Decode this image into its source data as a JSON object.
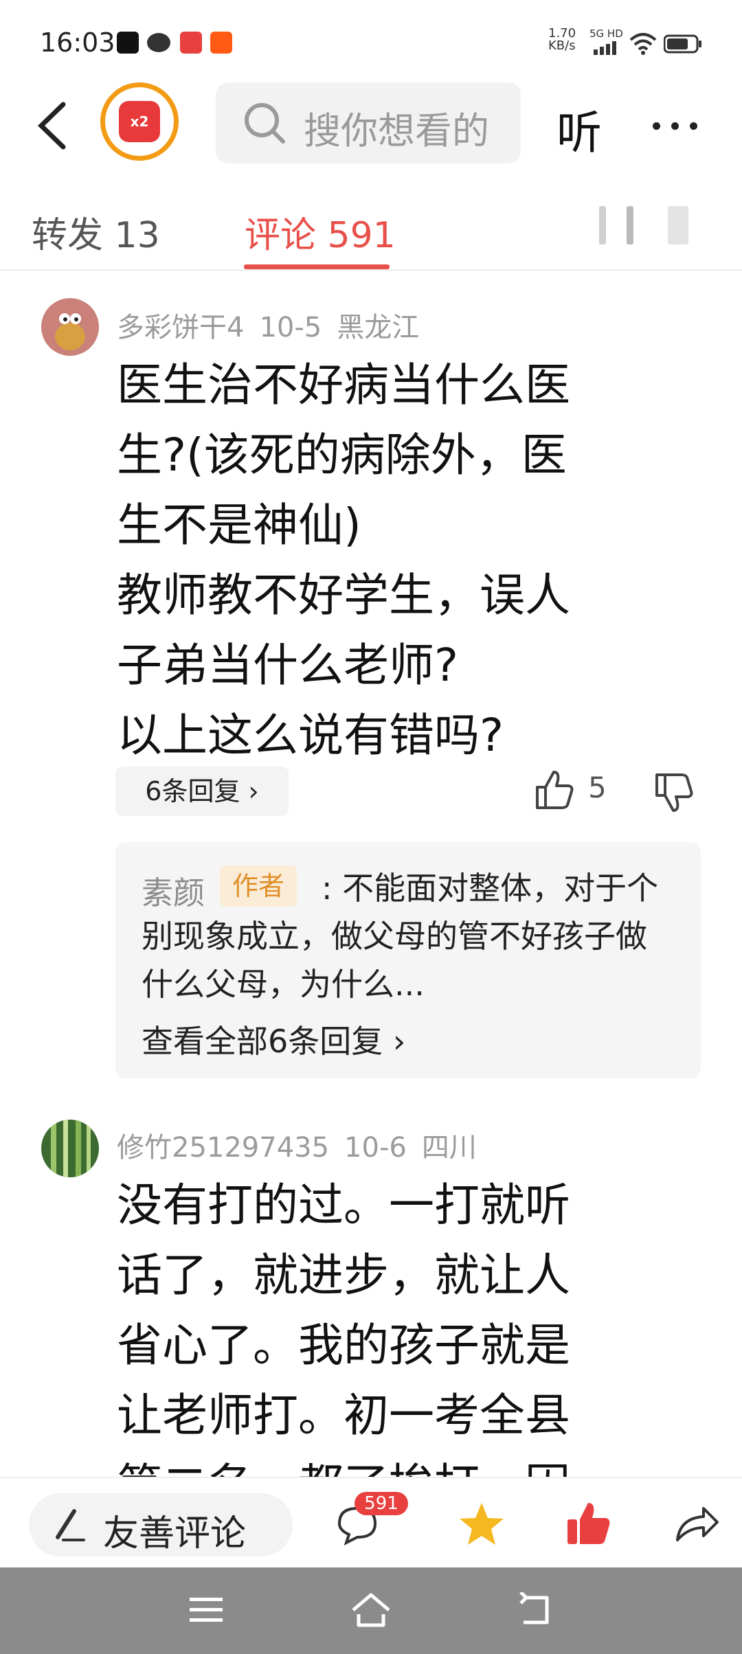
{
  "status": {
    "time": "16:03",
    "net_speed_top": "1.70",
    "net_speed_bottom": "KB/s",
    "network": "5G HD"
  },
  "header": {
    "avatar_badge": "x2",
    "search_placeholder": "搜你想看的",
    "listen_label": "听"
  },
  "tabs": {
    "repost": "转发 13",
    "comment": "评论 591"
  },
  "comments": [
    {
      "user": "多彩饼干4",
      "date": "10-5",
      "location": "黑龙江",
      "lines": [
        "医生治不好病当什么医",
        "生?(该死的病除外，医",
        "生不是神仙)",
        "教师教不好学生，误人",
        "子弟当什么老师?",
        "以上这么说有错吗?"
      ],
      "reply_button": "6条回复 ›",
      "likes": "5",
      "reply_preview": {
        "name": "素颜",
        "badge": "作者",
        "text": ": 不能面对整体，对于个别现象成立，做父母的管不好孩子做什么父母，为什么...",
        "view_all": "查看全部6条回复 ›"
      }
    },
    {
      "user": "修竹251297435",
      "date": "10-6",
      "location": "四川",
      "lines": [
        "没有打的过。一打就听",
        "话了，就进步，就让人",
        "省心了。我的孩子就是",
        "让老师打。初一考全县",
        "第二名，都了挨打，因"
      ]
    }
  ],
  "bottom_bar": {
    "comment_placeholder": "友善评论",
    "comment_count_badge": "591"
  }
}
